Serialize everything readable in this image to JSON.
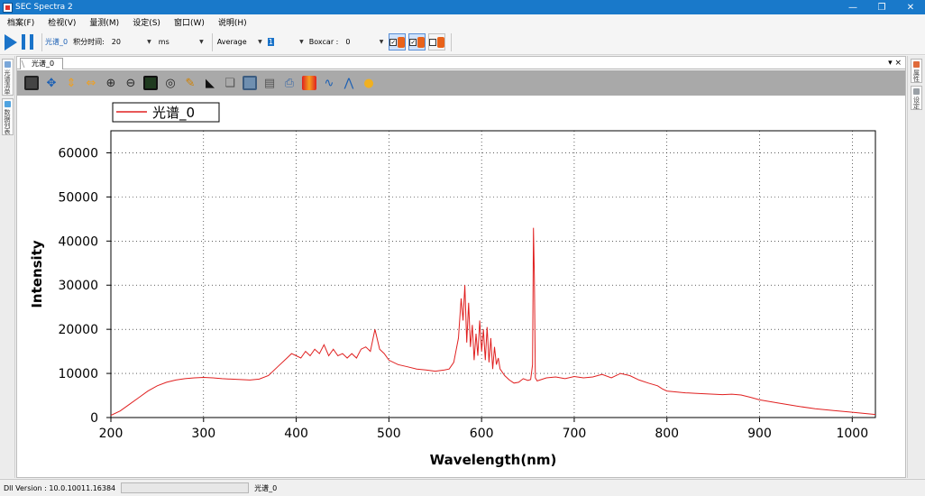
{
  "window": {
    "title": "SEC Spectra 2",
    "icon": "app-icon",
    "buttons": [
      "minimize",
      "restore",
      "close"
    ]
  },
  "menu": [
    "档案(F)",
    "检视(V)",
    "量测(M)",
    "设定(S)",
    "窗口(W)",
    "说明(H)"
  ],
  "toolbar": {
    "spectrum_name": "光谱_0",
    "integration_label": "积分时间:",
    "integration_value": "20",
    "unit_value": "ms",
    "average_label": "Average",
    "average_value": "1",
    "boxcar_label": "Boxcar :",
    "boxcar_value": "0"
  },
  "doc": {
    "tab_label": "光谱_0",
    "controls": "▾ ×"
  },
  "plot_toolbar_icons": [
    "table-icon",
    "fit-icon",
    "vertical-scale-icon",
    "horizontal-scale-icon",
    "zoom-in-icon",
    "zoom-out-icon",
    "crop-icon",
    "zoom-box-icon",
    "cursor-icon",
    "marker-icon",
    "copy-icon",
    "save-icon",
    "export-icon",
    "print-icon",
    "color-bar-icon",
    "peak-search-icon",
    "trace-icon",
    "pin-icon"
  ],
  "left_rail": [
    "光谱清单",
    "数据列表"
  ],
  "right_rail": [
    "属性",
    "设定"
  ],
  "colors": {
    "spectrum": "#e02020",
    "accent": "#1979ca"
  },
  "chart_data": {
    "type": "line",
    "legend": "光谱_0",
    "xlabel": "Wavelength(nm)",
    "ylabel": "Intensity",
    "xlim": [
      200,
      1025
    ],
    "ylim": [
      0,
      65000
    ],
    "xticks": [
      200,
      300,
      400,
      500,
      600,
      700,
      800,
      900,
      1000
    ],
    "yticks": [
      0,
      10000,
      20000,
      30000,
      40000,
      50000,
      60000
    ],
    "grid": true,
    "legend_position": "top-left",
    "series": [
      {
        "name": "光谱_0",
        "x": [
          200,
          210,
          220,
          230,
          240,
          250,
          260,
          270,
          280,
          290,
          300,
          310,
          320,
          330,
          340,
          350,
          360,
          370,
          380,
          390,
          395,
          400,
          405,
          410,
          415,
          420,
          425,
          430,
          435,
          440,
          445,
          450,
          455,
          460,
          465,
          470,
          475,
          480,
          485,
          490,
          495,
          500,
          510,
          520,
          530,
          540,
          550,
          560,
          565,
          570,
          575,
          578,
          580,
          582,
          584,
          586,
          588,
          590,
          592,
          594,
          596,
          598,
          600,
          602,
          604,
          606,
          608,
          610,
          612,
          614,
          616,
          618,
          620,
          625,
          630,
          635,
          640,
          645,
          650,
          653,
          655,
          656,
          657,
          658,
          660,
          670,
          680,
          690,
          700,
          710,
          720,
          730,
          740,
          750,
          760,
          770,
          780,
          790,
          795,
          800,
          810,
          820,
          830,
          840,
          850,
          860,
          870,
          880,
          890,
          900,
          920,
          940,
          960,
          980,
          1000,
          1025
        ],
        "y": [
          500,
          1500,
          3000,
          4500,
          6000,
          7200,
          8000,
          8500,
          8800,
          9000,
          9100,
          9000,
          8800,
          8700,
          8600,
          8500,
          8700,
          9500,
          11500,
          13500,
          14500,
          14000,
          13500,
          15000,
          14000,
          15500,
          14500,
          16500,
          14000,
          15500,
          14000,
          14500,
          13500,
          14500,
          13500,
          15500,
          16000,
          15000,
          20000,
          15500,
          14500,
          13000,
          12000,
          11500,
          11000,
          10800,
          10500,
          10800,
          11000,
          12500,
          18000,
          27000,
          22000,
          30000,
          17000,
          26000,
          16000,
          21000,
          13000,
          19000,
          14000,
          22000,
          15000,
          20000,
          13000,
          20500,
          12500,
          18000,
          11000,
          16000,
          12000,
          13500,
          11000,
          9500,
          8500,
          7800,
          8000,
          8800,
          8400,
          8600,
          12000,
          43000,
          32000,
          9000,
          8300,
          9000,
          9200,
          8800,
          9300,
          9000,
          9200,
          9800,
          9000,
          10000,
          9500,
          8500,
          7800,
          7200,
          6500,
          6000,
          5800,
          5600,
          5500,
          5400,
          5300,
          5200,
          5300,
          5100,
          4600,
          4000,
          3300,
          2600,
          2000,
          1600,
          1200,
          700
        ]
      }
    ]
  },
  "statusbar": {
    "dll_version": "Dll Version : 10.0.10011.16384",
    "spectrum_name": "光谱_0"
  }
}
